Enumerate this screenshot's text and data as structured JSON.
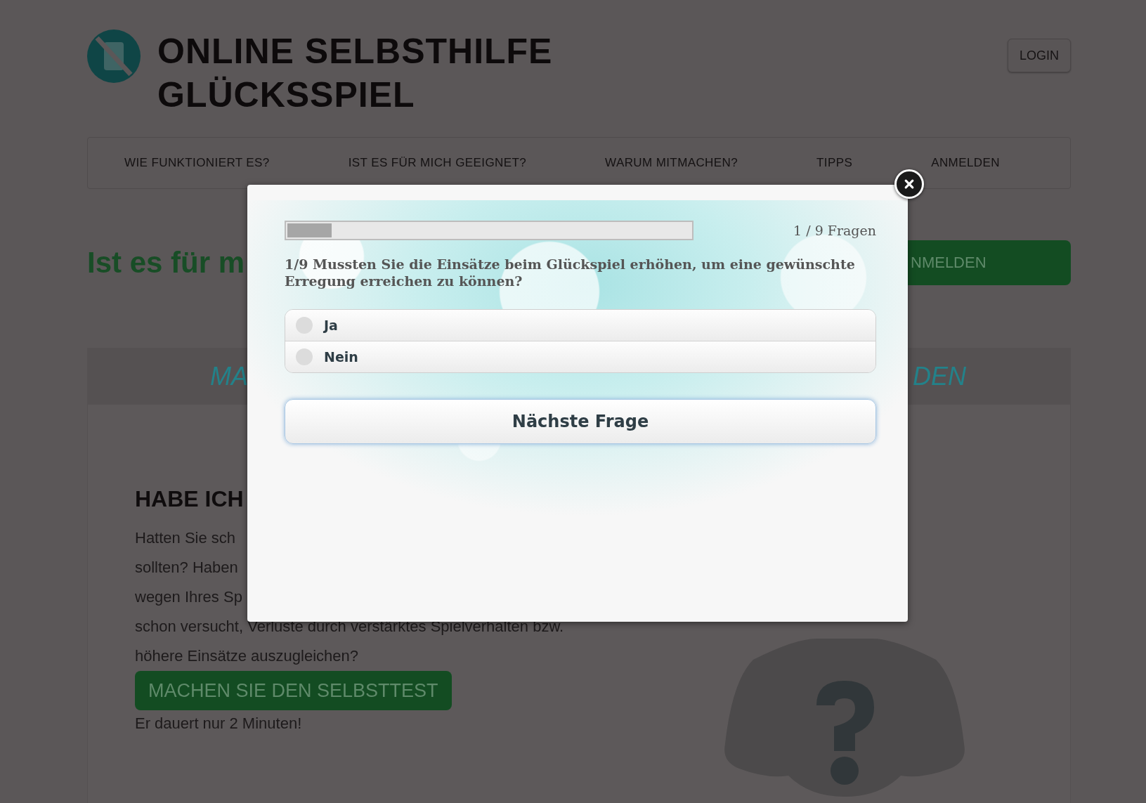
{
  "header": {
    "title_lines": [
      "ONLINE SELBSTHILFE",
      "GLÜCKSSPIEL"
    ],
    "login": "LOGIN"
  },
  "nav": [
    {
      "label": "WIE FUNKTIONIERT ES?"
    },
    {
      "label": "IST ES FÜR MICH GEEIGNET?"
    },
    {
      "label": "WARUM MITMACHEN?"
    },
    {
      "label": "TIPPS"
    },
    {
      "label": "ANMELDEN"
    }
  ],
  "page": {
    "heading": "Ist es für m",
    "signup_button": "NMELDEN",
    "card": {
      "tab_left": "MA",
      "tab_right": "DEN",
      "title": "HABE ICH",
      "paragraph_lines": [
        "Hatten Sie sch",
        "sollten? Haben",
        "wegen Ihres Sp",
        "schon versucht, Verluste durch verstärktes Spielverhalten bzw.",
        "höhere Einsätze auszugleichen?"
      ],
      "test_button": "MACHEN SIE DEN SELBSTTEST",
      "note": "Er dauert nur 2 Minuten!"
    }
  },
  "quiz": {
    "progress": {
      "level": 0.11,
      "label": "1 / 9 Fragen"
    },
    "question": "1/9 Mussten Sie die Einsätze beim Glückspiel erhöhen, um eine gewünschte Erregung erreichen zu können?",
    "options": [
      {
        "label": "Ja",
        "selected": false
      },
      {
        "label": "Nein",
        "selected": false
      }
    ],
    "next_button": "Nächste Frage"
  }
}
